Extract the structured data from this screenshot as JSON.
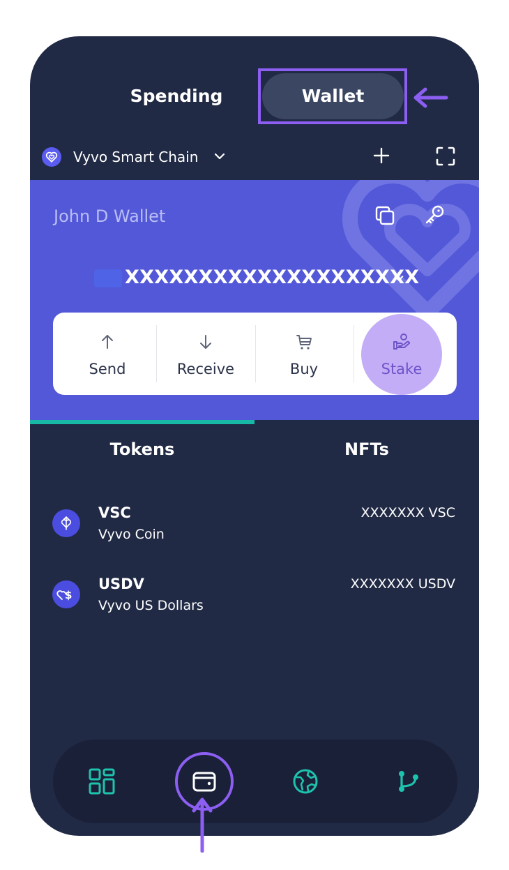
{
  "tabs": {
    "spending": "Spending",
    "wallet": "Wallet"
  },
  "chain": {
    "name": "Vyvo Smart Chain"
  },
  "wallet": {
    "name": "John D Wallet",
    "address": "XXXXXXXXXXXXXXXXXXXX"
  },
  "actions": {
    "send": "Send",
    "receive": "Receive",
    "buy": "Buy",
    "stake": "Stake"
  },
  "token_tabs": {
    "tokens": "Tokens",
    "nfts": "NFTs"
  },
  "tokens": [
    {
      "symbol": "VSC",
      "name": "Vyvo Coin",
      "balance": "XXXXXXX VSC",
      "icon": "vyvo-coin-icon"
    },
    {
      "symbol": "USDV",
      "name": "Vyvo US Dollars",
      "balance": "XXXXXXX USDV",
      "icon": "usdv-icon"
    }
  ],
  "colors": {
    "background": "#212a45",
    "card": "#5358d8",
    "accent_teal": "#17b8a6",
    "highlight_purple": "#8c5ff2",
    "stake_circle": "#c3adf6"
  },
  "bottom_nav": [
    "dashboard-icon",
    "wallet-icon",
    "globe-icon",
    "branch-icon"
  ]
}
